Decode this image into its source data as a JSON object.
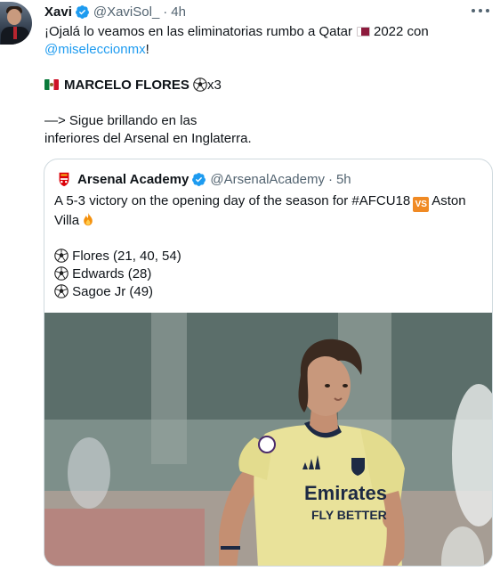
{
  "tweet": {
    "author_name": "Xavi",
    "handle": "@XaviSol_",
    "separator": "·",
    "time": "4h",
    "line1": "¡Ojalá lo veamos en las eliminatorias rumbo a Qatar",
    "line1_year": "2022 con",
    "mention": "@miseleccionmx",
    "mention_suffix": "!",
    "player_name": "MARCELO FLORES",
    "goals_count": "x3",
    "line_arrow": "—> Sigue brillando en las",
    "line_last": "inferiores del Arsenal en Inglaterra.",
    "icons": [
      "verified-badge-icon",
      "qatar-flag-icon",
      "mexico-flag-icon",
      "soccer-ball-icon",
      "more-options-icon"
    ]
  },
  "quoted": {
    "author_name": "Arsenal Academy",
    "handle": "@ArsenalAcademy",
    "separator": "·",
    "time": "5h",
    "line1": "A 5-3 victory on the opening day of the season for #AFCU18",
    "vs_badge": "VS",
    "line1_end": "Aston",
    "line2": "Villa",
    "scorers": [
      "Flores (21, 40, 54)",
      "Edwards (28)",
      "Sagoe Jr (49)"
    ],
    "image_alt": "Player in yellow Arsenal away kit running on pitch",
    "shirt_text_1": "Emirates",
    "shirt_text_2": "FLY BETTER"
  },
  "colors": {
    "link": "#1d9bf0",
    "secondary_text": "#536471",
    "border": "#cfd9de",
    "verified": "#1d9bf0",
    "kit_yellow": "#e9e29a",
    "kit_navy": "#1d2a44"
  }
}
